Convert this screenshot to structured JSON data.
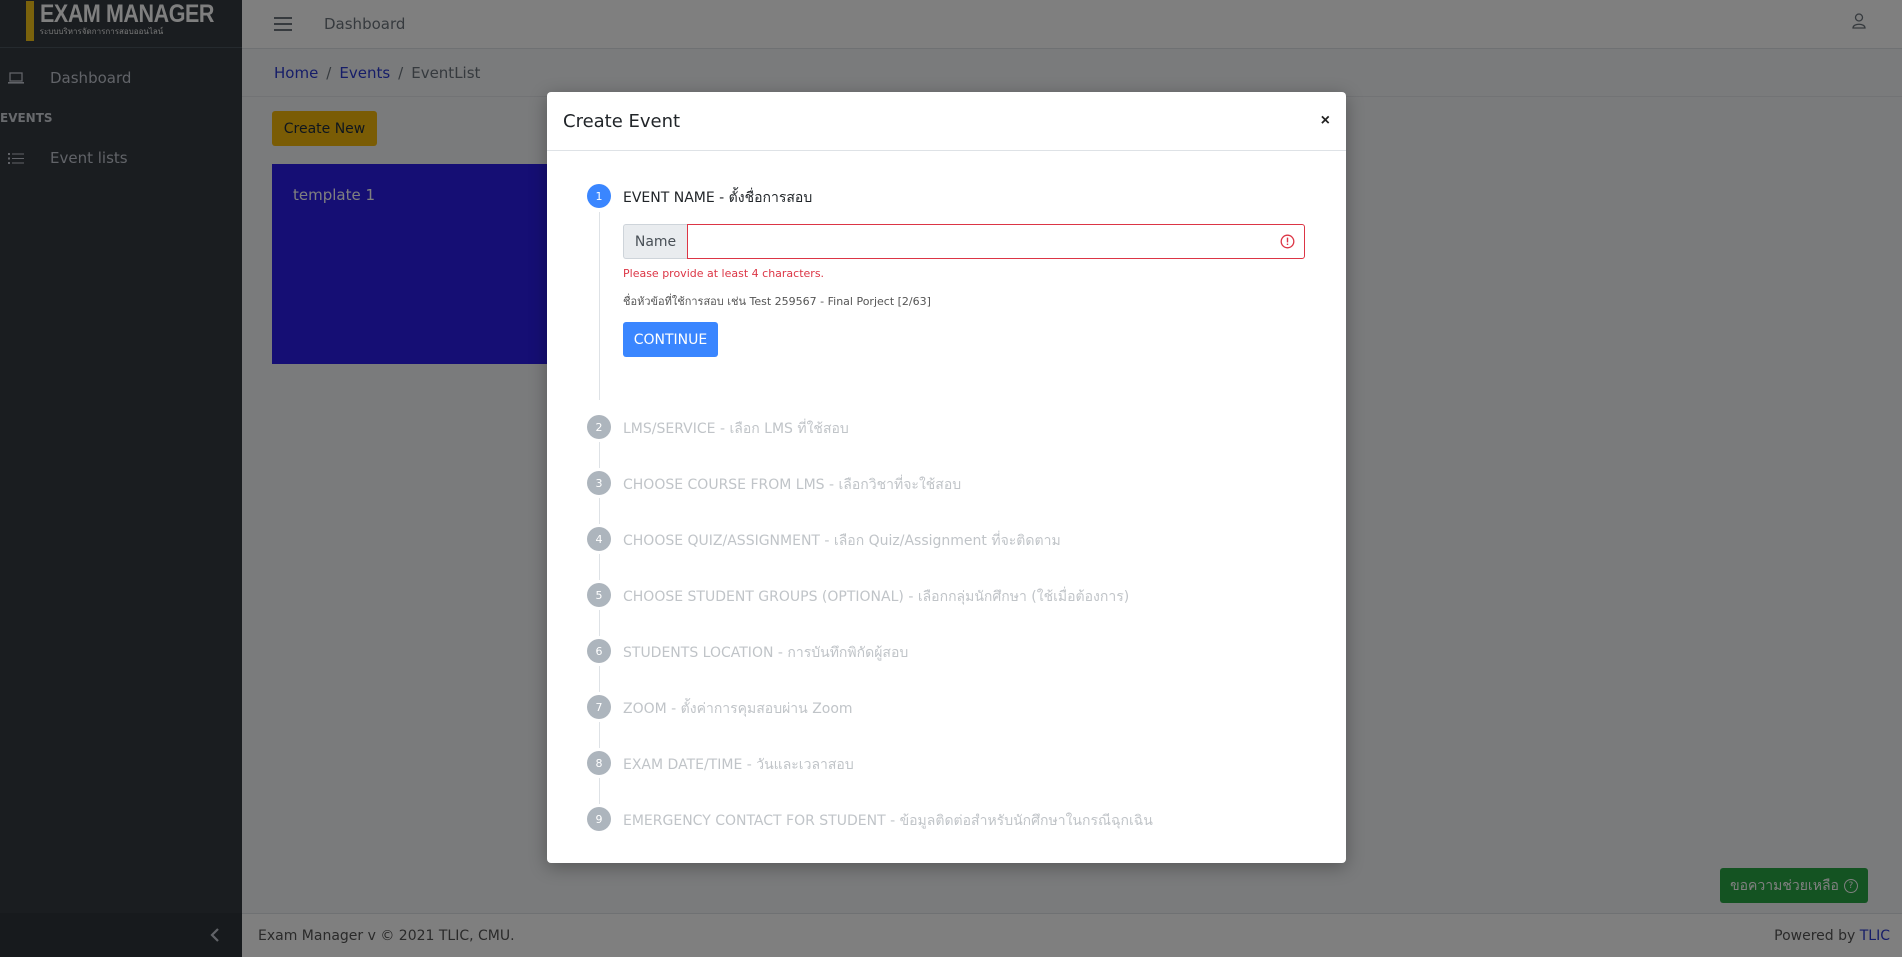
{
  "brand": {
    "title": "EXAM MANAGER",
    "subtitle": "ระบบบริหารจัดการการสอบออนไลน์"
  },
  "sidebar": {
    "items": [
      {
        "label": "Dashboard",
        "icon": "laptop-icon"
      }
    ],
    "section_header": "EVENTS",
    "section_items": [
      {
        "label": "Event lists",
        "icon": "list-icon"
      }
    ],
    "collapse_icon": "chevron-left-icon"
  },
  "topbar": {
    "title": "Dashboard",
    "menu_icon": "hamburger-icon",
    "user_icon": "user-icon"
  },
  "breadcrumb": {
    "items": [
      "Home",
      "Events"
    ],
    "current": "EventList"
  },
  "main": {
    "create_new_label": "Create New",
    "card_title": "template 1"
  },
  "footer": {
    "left": "Exam Manager v  © 2021 TLIC, CMU.",
    "right_prefix": "Powered by",
    "right_link": "TLIC"
  },
  "help": {
    "label": "ขอความช่วยเหลือ",
    "icon": "question-circle-icon"
  },
  "modal": {
    "title": "Create Event",
    "close_label": "×",
    "form": {
      "addon_label": "Name",
      "value": "",
      "error": "Please provide at least 4 characters.",
      "hint": "ชื่อหัวข้อที่ใช้การสอบ เช่น Test 259567 - Final Porject [2/63]",
      "continue_label": "CONTINUE"
    },
    "steps": [
      {
        "num": "1",
        "title": "EVENT NAME - ตั้งชื่อการสอบ",
        "active": true
      },
      {
        "num": "2",
        "title": "LMS/SERVICE - เลือก LMS ที่ใช้สอบ",
        "active": false
      },
      {
        "num": "3",
        "title": "CHOOSE COURSE FROM LMS - เลือกวิชาที่จะใช้สอบ",
        "active": false
      },
      {
        "num": "4",
        "title": "CHOOSE QUIZ/ASSIGNMENT - เลือก Quiz/Assignment ที่จะติดตาม",
        "active": false
      },
      {
        "num": "5",
        "title": "CHOOSE STUDENT GROUPS (OPTIONAL) - เลือกกลุ่มนักศึกษา (ใช้เมื่อต้องการ)",
        "active": false
      },
      {
        "num": "6",
        "title": "STUDENTS LOCATION - การบันทึกพิกัดผู้สอบ",
        "active": false
      },
      {
        "num": "7",
        "title": "ZOOM - ตั้งค่าการคุมสอบผ่าน Zoom",
        "active": false
      },
      {
        "num": "8",
        "title": "EXAM DATE/TIME - วันและเวลาสอบ",
        "active": false
      },
      {
        "num": "9",
        "title": "EMERGENCY CONTACT FOR STUDENT - ข้อมูลติดต่อสำหรับนักศึกษาในกรณีฉุกเฉิน",
        "active": false
      }
    ]
  },
  "colors": {
    "sidebar": "#343a40",
    "primary": "#3a86ff",
    "warning": "#f5b90a",
    "success": "#28a745",
    "danger": "#dc3545",
    "card": "#2a1de8"
  }
}
